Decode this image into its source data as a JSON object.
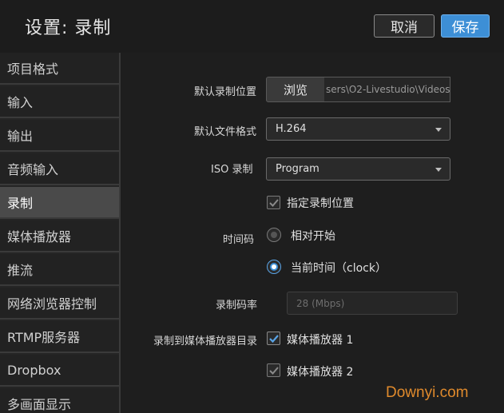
{
  "header": {
    "title": "设置: 录制",
    "cancel_label": "取消",
    "save_label": "保存"
  },
  "sidebar": {
    "items": [
      {
        "label": "项目格式"
      },
      {
        "label": "输入"
      },
      {
        "label": "输出"
      },
      {
        "label": "音频输入"
      },
      {
        "label": "录制"
      },
      {
        "label": "媒体播放器"
      },
      {
        "label": "推流"
      },
      {
        "label": "网络浏览器控制"
      },
      {
        "label": "RTMP服务器"
      },
      {
        "label": "Dropbox"
      },
      {
        "label": "多画面显示"
      }
    ]
  },
  "form": {
    "default_location_label": "默认录制位置",
    "browse_label": "浏览",
    "path_value": "sers\\O2-Livestudio\\Videos\\",
    "default_format_label": "默认文件格式",
    "format_value": "H.264",
    "iso_label": "ISO 录制",
    "iso_value": "Program",
    "specify_location_label": "指定录制位置",
    "timecode_label": "时间码",
    "timecode_relative_label": "相对开始",
    "timecode_current_label": "当前时间（clock）",
    "bitrate_label": "录制码率",
    "bitrate_placeholder": "28 (Mbps)",
    "mediaplayer_dir_label": "录制到媒体播放器目录",
    "mediaplayer1_label": "媒体播放器 1",
    "mediaplayer2_label": "媒体播放器 2"
  },
  "watermark": "Downyi.com",
  "colors": {
    "accent": "#3d8fd6",
    "background": "#1e1e1e",
    "sidebar_active": "#4a4a4a",
    "watermark": "#e08a2c"
  }
}
